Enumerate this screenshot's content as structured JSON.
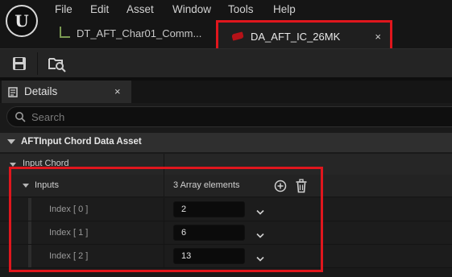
{
  "menu": {
    "items": [
      "File",
      "Edit",
      "Asset",
      "Window",
      "Tools",
      "Help"
    ]
  },
  "tabs": {
    "char_tab_label": "DT_AFT_Char01_Comm...",
    "asset_tab_label": "DA_AFT_IC_26MK",
    "close_glyph": "×"
  },
  "details": {
    "title": "Details",
    "close_glyph": "×",
    "search_placeholder": "Search",
    "category": "AFTInput Chord Data Asset",
    "input_chord_label": "Input Chord",
    "inputs_label": "Inputs",
    "array_count": "3 Array elements",
    "elements": [
      {
        "label": "Index [ 0 ]",
        "value": "2"
      },
      {
        "label": "Index [ 1 ]",
        "value": "6"
      },
      {
        "label": "Index [ 2 ]",
        "value": "13"
      }
    ]
  },
  "colors": {
    "highlight": "#e0161d",
    "background": "#151515",
    "panel": "#1a1a1a"
  },
  "icons": [
    "unreal-logo-icon",
    "data-table-icon",
    "data-asset-icon",
    "save-icon",
    "browse-icon",
    "details-icon",
    "search-icon",
    "add-element-icon",
    "trash-icon",
    "chevron-down-icon"
  ]
}
